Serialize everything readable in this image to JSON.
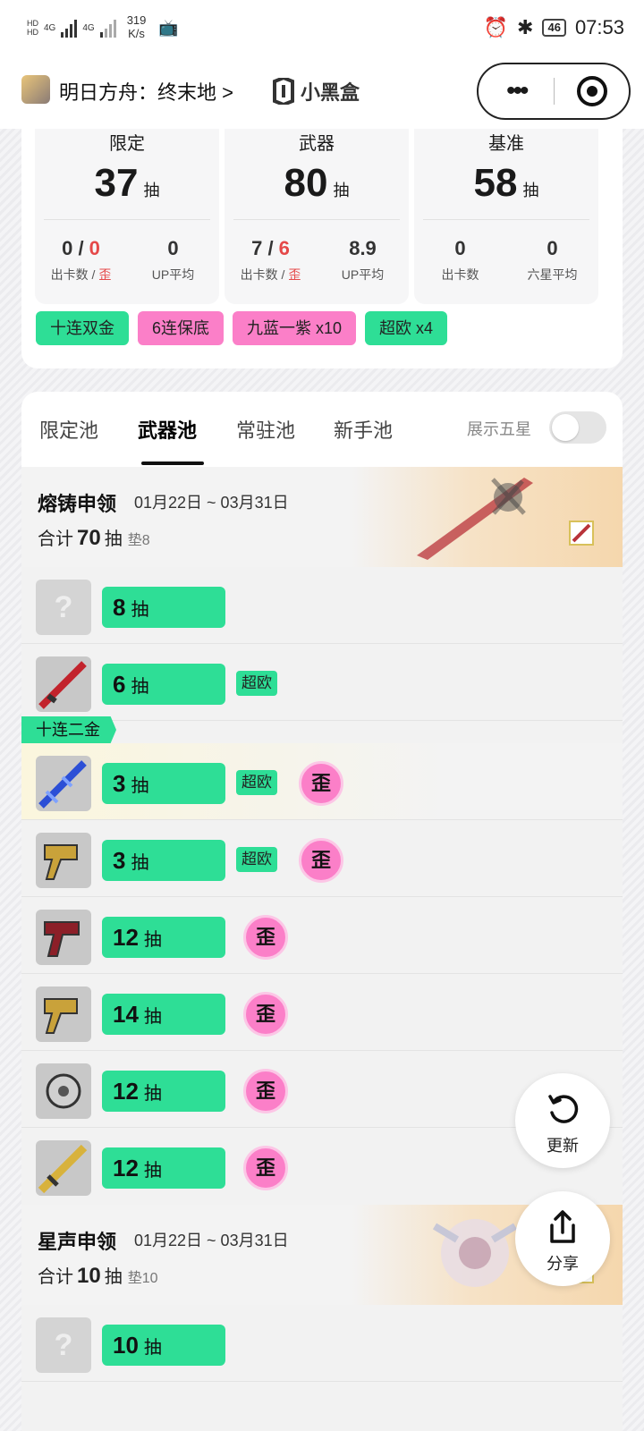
{
  "status": {
    "net_speed": "319",
    "net_unit": "K/s",
    "signal1": "4G",
    "signal2": "4G",
    "battery": "46",
    "time": "07:53"
  },
  "nav": {
    "app_title": "明日方舟：终末地 >",
    "brand": "小黑盒"
  },
  "summary": [
    {
      "header": "限定",
      "count": "37",
      "unit": "抽",
      "left_value": "0",
      "left_value_red": "0",
      "left_label": "出卡数 / ",
      "left_label_red": "歪",
      "right_value": "0",
      "right_label": "UP平均"
    },
    {
      "header": "武器",
      "count": "80",
      "unit": "抽",
      "left_value": "7",
      "left_value_red": "6",
      "left_label": "出卡数 / ",
      "left_label_red": "歪",
      "right_value": "8.9",
      "right_label": "UP平均"
    },
    {
      "header": "基准",
      "count": "58",
      "unit": "抽",
      "left_value": "0",
      "left_value_red": "",
      "left_label": "出卡数",
      "left_label_red": "",
      "right_value": "0",
      "right_label": "六星平均"
    }
  ],
  "tags": [
    "十连双金",
    "6连保底",
    "九蓝一紫 x10",
    "超欧 x4"
  ],
  "tabs": [
    "限定池",
    "武器池",
    "常驻池",
    "新手池"
  ],
  "active_tab": "武器池",
  "show_five_star": {
    "label": "展示五星",
    "on": false
  },
  "unit": "抽",
  "total_prefix": "合计",
  "banners": [
    {
      "name": "熔铸申领",
      "dates": "01月22日 ~ 03月31日",
      "total": "70",
      "pad": "垫8"
    },
    {
      "name": "星声申领",
      "dates": "01月22日 ~ 03月31日",
      "total": "10",
      "pad": "垫10"
    }
  ],
  "ribbon": "十连二金",
  "pulls": [
    {
      "count": "8",
      "badge": "",
      "wai": "",
      "item": "unknown-icon"
    },
    {
      "count": "6",
      "badge": "超欧",
      "wai": "",
      "item": "red-sword-icon"
    },
    {
      "count": "3",
      "badge": "超欧",
      "wai": "歪",
      "item": "blue-sword-icon"
    },
    {
      "count": "3",
      "badge": "超欧",
      "wai": "歪",
      "item": "gold-gun-icon"
    },
    {
      "count": "12",
      "badge": "",
      "wai": "歪",
      "item": "red-gun-icon"
    },
    {
      "count": "14",
      "badge": "",
      "wai": "歪",
      "item": "gold-gun-icon"
    },
    {
      "count": "12",
      "badge": "",
      "wai": "歪",
      "item": "silver-gauntlet-icon"
    },
    {
      "count": "12",
      "badge": "",
      "wai": "歪",
      "item": "gold-sword-icon"
    }
  ],
  "pulls2": [
    {
      "count": "10",
      "badge": "",
      "wai": "",
      "item": "unknown-icon"
    }
  ],
  "fab": {
    "refresh": "更新",
    "share": "分享"
  },
  "colors": {
    "green": "#2ede96",
    "pink": "#fb7fc8",
    "red": "#e54848"
  }
}
